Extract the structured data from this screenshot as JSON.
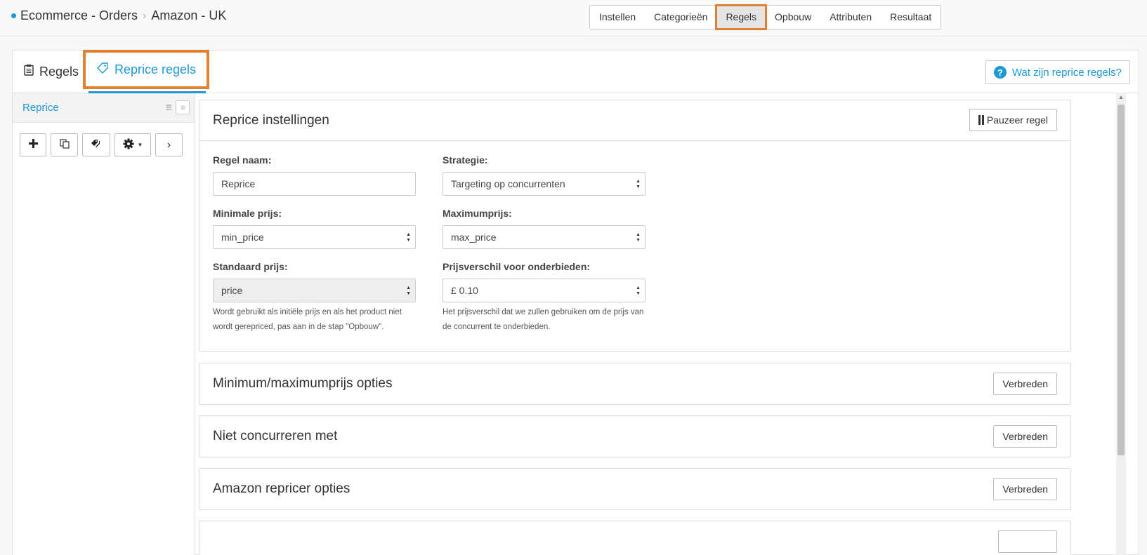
{
  "breadcrumb": {
    "part1": "Ecommerce - Orders",
    "part2": "Amazon - UK"
  },
  "steps": [
    "Instellen",
    "Categorieën",
    "Regels",
    "Opbouw",
    "Attributen",
    "Resultaat"
  ],
  "active_step": "Regels",
  "tabs": {
    "rules": "Regels",
    "reprice": "Reprice regels"
  },
  "help_button": "Wat zijn reprice regels?",
  "sidebar": {
    "rule_name": "Reprice"
  },
  "settings": {
    "title": "Reprice instellingen",
    "pause_label": "Pauzeer regel",
    "rule_name_label": "Regel naam:",
    "rule_name_value": "Reprice",
    "strategy_label": "Strategie:",
    "strategy_value": "Targeting op concurrenten",
    "min_price_label": "Minimale prijs:",
    "min_price_value": "min_price",
    "max_price_label": "Maximumprijs:",
    "max_price_value": "max_price",
    "std_price_label": "Standaard prijs:",
    "std_price_value": "price",
    "std_price_hint": "Wordt gebruikt als initiële prijs en als het product niet wordt gerepriced, pas aan in de stap \"Opbouw\".",
    "diff_label": "Prijsverschil voor onderbieden:",
    "diff_value": "£ 0.10",
    "diff_hint": "Het prijsverschil dat we zullen gebruiken om de prijs van de concurrent te onderbieden."
  },
  "sections": {
    "minmax": "Minimum/maximumprijs opties",
    "no_compete": "Niet concurreren met",
    "amazon": "Amazon repricer opties",
    "expand_label": "Verbreden"
  },
  "colors": {
    "accent": "#1b98d5",
    "highlight": "#e47e30"
  }
}
